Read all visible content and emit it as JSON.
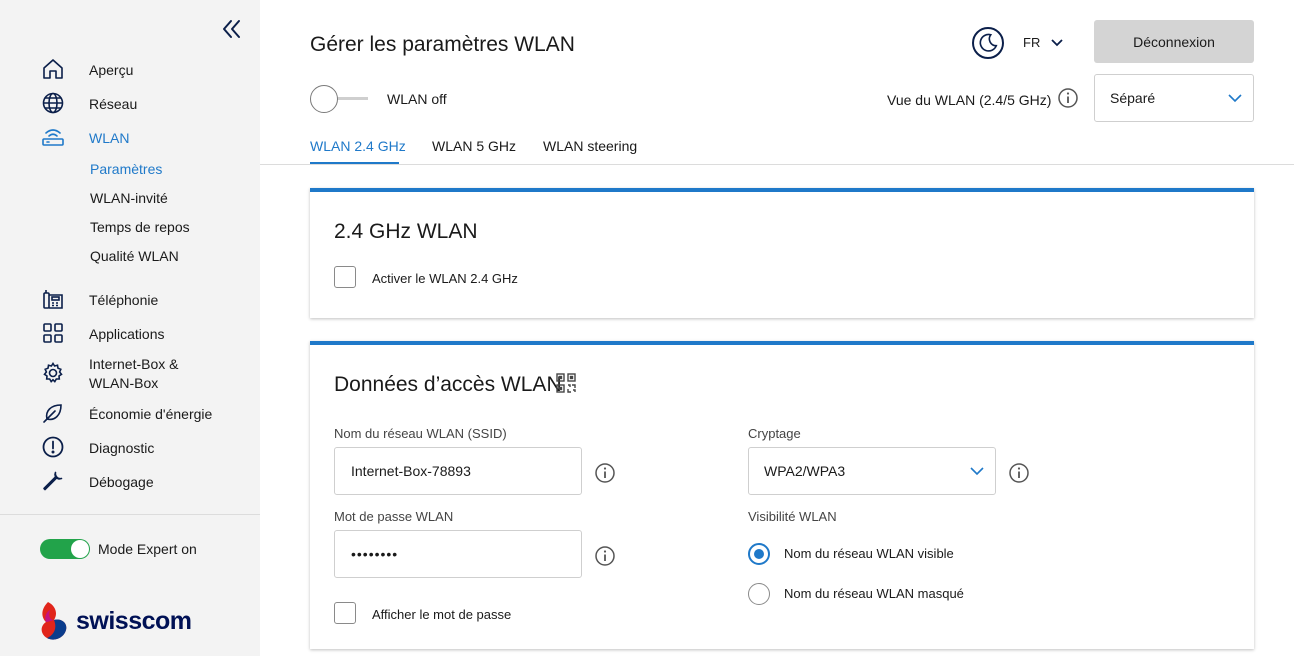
{
  "sidebar": {
    "nav": [
      {
        "label": "Aperçu",
        "icon": "home-icon"
      },
      {
        "label": "Réseau",
        "icon": "globe-icon"
      },
      {
        "label": "WLAN",
        "icon": "wifi-router-icon"
      },
      {
        "label": "Téléphonie",
        "icon": "phone-icon"
      },
      {
        "label": "Applications",
        "icon": "apps-grid-icon"
      },
      {
        "label": "Internet-Box &",
        "label2": "WLAN-Box",
        "icon": "gear-icon"
      },
      {
        "label": "Économie d'énergie",
        "icon": "leaf-icon"
      },
      {
        "label": "Diagnostic",
        "icon": "alert-circle-icon"
      },
      {
        "label": "Débogage",
        "icon": "wrench-icon"
      }
    ],
    "wlan_sub": [
      {
        "label": "Paramètres"
      },
      {
        "label": "WLAN-invité"
      },
      {
        "label": "Temps de repos"
      },
      {
        "label": "Qualité WLAN"
      }
    ],
    "expert_label": "Mode Expert on",
    "logo_text": "swisscom"
  },
  "header": {
    "title": "Gérer les paramètres WLAN",
    "lang": "FR",
    "logout": "Déconnexion",
    "wlan_state": "WLAN off",
    "view_label": "Vue du WLAN (2.4/5 GHz)",
    "view_value": "Séparé"
  },
  "tabs": [
    {
      "label": "WLAN 2.4 GHz"
    },
    {
      "label": "WLAN 5 GHz"
    },
    {
      "label": "WLAN steering"
    }
  ],
  "card1": {
    "title": "2.4 GHz WLAN",
    "checkbox_label": "Activer le WLAN 2.4 GHz"
  },
  "card2": {
    "title": "Données d’accès WLAN",
    "ssid_label": "Nom du réseau WLAN (SSID)",
    "ssid_value": "Internet-Box-78893",
    "password_label": "Mot de passe WLAN",
    "password_value": "••••••••",
    "show_password_label": "Afficher le mot de passe",
    "crypto_label": "Cryptage",
    "crypto_value": "WPA2/WPA3",
    "visibility_label": "Visibilité WLAN",
    "visible_option": "Nom du réseau WLAN visible",
    "hidden_option": "Nom du réseau WLAN masqué"
  },
  "colors": {
    "accent": "#1f79c9",
    "expert_toggle": "#22a34a",
    "brand_navy": "#001155",
    "brand_red": "#e1251b"
  }
}
